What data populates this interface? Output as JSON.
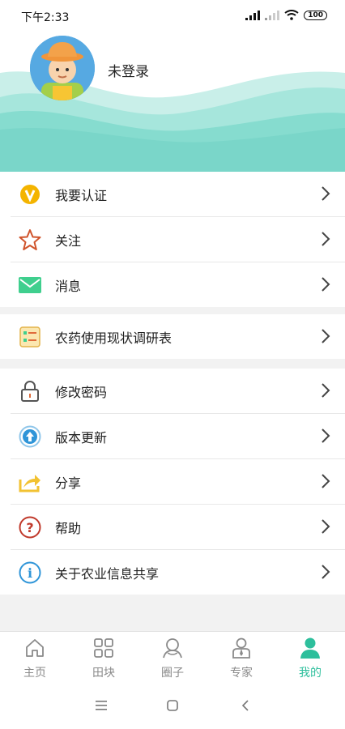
{
  "status": {
    "time": "下午2:33",
    "battery": "100"
  },
  "profile": {
    "login_text": "未登录"
  },
  "colors": {
    "accent": "#2dbf9c",
    "wave": "#7fd9cc"
  },
  "groups": [
    {
      "items": [
        {
          "label": "我要认证",
          "icon": "verify-icon"
        },
        {
          "label": "关注",
          "icon": "star-icon"
        },
        {
          "label": "消息",
          "icon": "mail-icon"
        }
      ]
    },
    {
      "items": [
        {
          "label": "农药使用现状调研表",
          "icon": "survey-icon"
        }
      ]
    },
    {
      "items": [
        {
          "label": "修改密码",
          "icon": "lock-icon"
        },
        {
          "label": "版本更新",
          "icon": "upload-icon"
        },
        {
          "label": "分享",
          "icon": "share-icon"
        },
        {
          "label": "帮助",
          "icon": "help-icon"
        },
        {
          "label": "关于农业信息共享",
          "icon": "info-icon"
        }
      ]
    }
  ],
  "nav": [
    {
      "label": "主页",
      "icon": "home-icon"
    },
    {
      "label": "田块",
      "icon": "grid-icon"
    },
    {
      "label": "圈子",
      "icon": "circle-icon"
    },
    {
      "label": "专家",
      "icon": "expert-icon"
    },
    {
      "label": "我的",
      "icon": "person-icon",
      "active": true
    }
  ]
}
